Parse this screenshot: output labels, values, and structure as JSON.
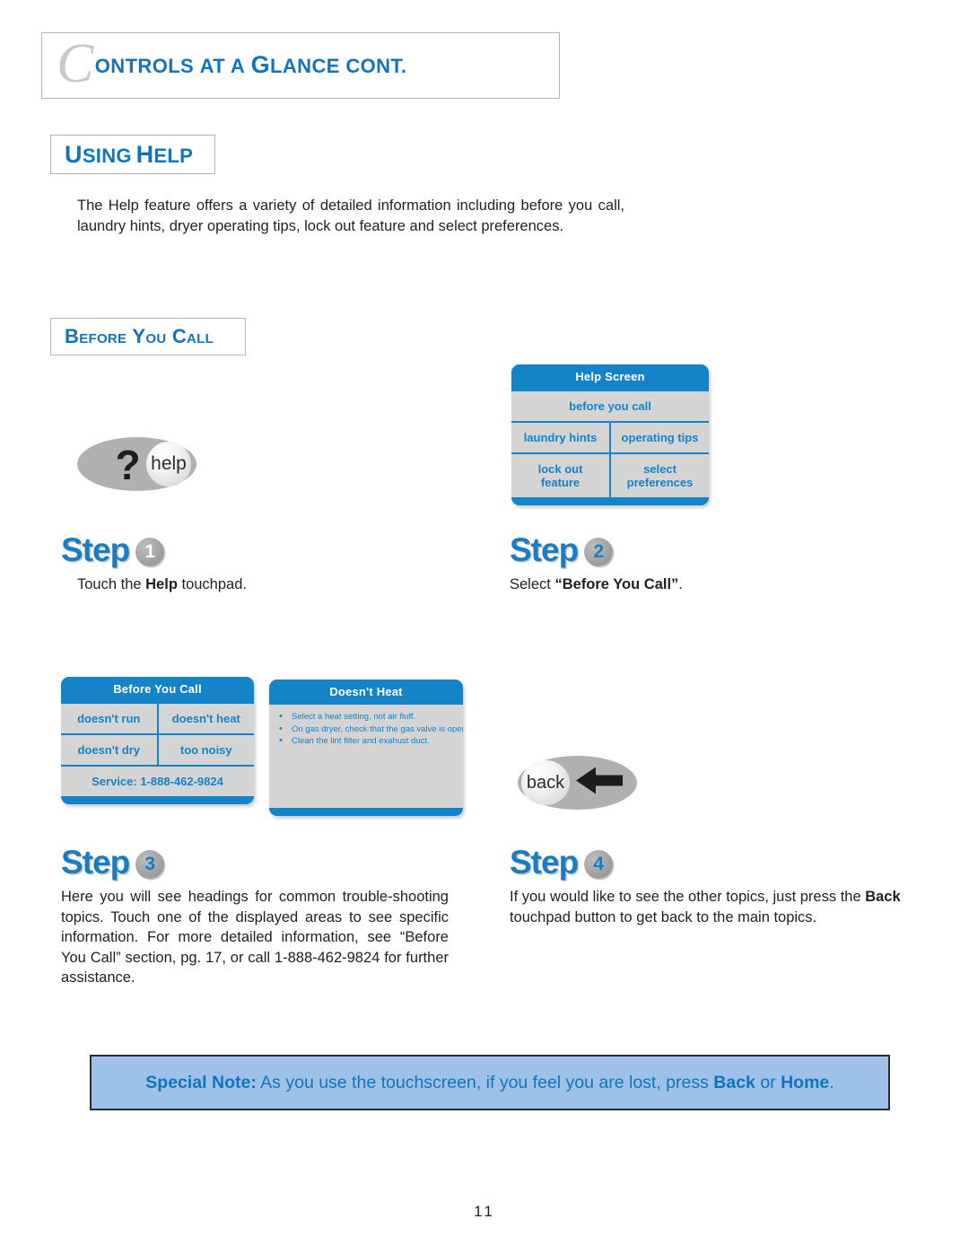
{
  "page": {
    "title_dropcap": "C",
    "title_rest_1": "ONTROLS",
    "title_rest_2": "AT A",
    "title_g": "G",
    "title_rest_3": "LANCE CONT.",
    "title_full": "Controls at a Glance cont.",
    "page_number": "11"
  },
  "sections": {
    "using_help": {
      "heading_first": "U",
      "heading_rest": "SING",
      "heading_first2": "H",
      "heading_rest2": "ELP",
      "heading": "Using Help",
      "paragraph": "The Help feature offers a variety of detailed information including before you call, laundry hints, dryer operating tips, lock out feature and select preferences."
    },
    "before_you_call": {
      "heading": "Before You Call"
    }
  },
  "steps": [
    {
      "word": "Step",
      "number": "1",
      "caption_before": "Touch the ",
      "caption_bold": "Help",
      "caption_after": " touchpad."
    },
    {
      "word": "Step",
      "number": "2",
      "caption_before": "Select ",
      "caption_bold": "“Before You Call”",
      "caption_after": "."
    },
    {
      "word": "Step",
      "number": "3",
      "paragraph": "Here you will see headings for common trouble-shooting topics. Touch one of the displayed areas to see specific information. For more detailed information, see “Before You Call” section, pg. 17, or call 1-888-462-9824 for further assistance."
    },
    {
      "word": "Step",
      "number": "4",
      "paragraph_before": "If you would like to see the other topics, just press the ",
      "paragraph_bold": "Back",
      "paragraph_after": " touchpad button to get back to the main topics."
    }
  ],
  "screens": {
    "help_screen": {
      "header": "Help Screen",
      "rows": [
        [
          "before you call"
        ],
        [
          "laundry hints",
          "operating tips"
        ],
        [
          "lock out\nfeature",
          "select\npreferences"
        ]
      ],
      "cell_lock_out_line1": "lock out",
      "cell_lock_out_line2": "feature",
      "cell_select_line1": "select",
      "cell_select_line2": "preferences",
      "cell_before_you_call": "before you call",
      "cell_laundry_hints": "laundry hints",
      "cell_operating_tips": "operating tips"
    },
    "before_you_call_screen": {
      "header": "Before You Call",
      "cell_doesnt_run": "doesn't run",
      "cell_doesnt_heat": "doesn't heat",
      "cell_doesnt_dry": "doesn't dry",
      "cell_too_noisy": "too noisy",
      "cell_service": "Service: 1-888-462-9824"
    },
    "doesnt_heat_screen": {
      "header": "Doesn't Heat",
      "bullets": [
        "Select a heat setting, not air fluff.",
        "On gas dryer, check that the gas valve is open.",
        "Clean the lint filter and exahust duct."
      ]
    }
  },
  "touchpads": {
    "help": {
      "question_mark": "?",
      "label": "help"
    },
    "back": {
      "label": "back",
      "arrow": "left-arrow"
    }
  },
  "special_note": {
    "label": "Special Note:",
    "text_1": " As you use the touchscreen, if you feel you are lost, press ",
    "bold_1": "Back",
    "text_2": " or ",
    "bold_2": "Home",
    "text_3": "."
  },
  "colors": {
    "brand_blue": "#1274bc",
    "screen_blue": "#1483c8",
    "screen_gray": "#d4d4d4",
    "note_bg": "#9dc1e8",
    "touchpad_gray": "#b0b0b0"
  }
}
